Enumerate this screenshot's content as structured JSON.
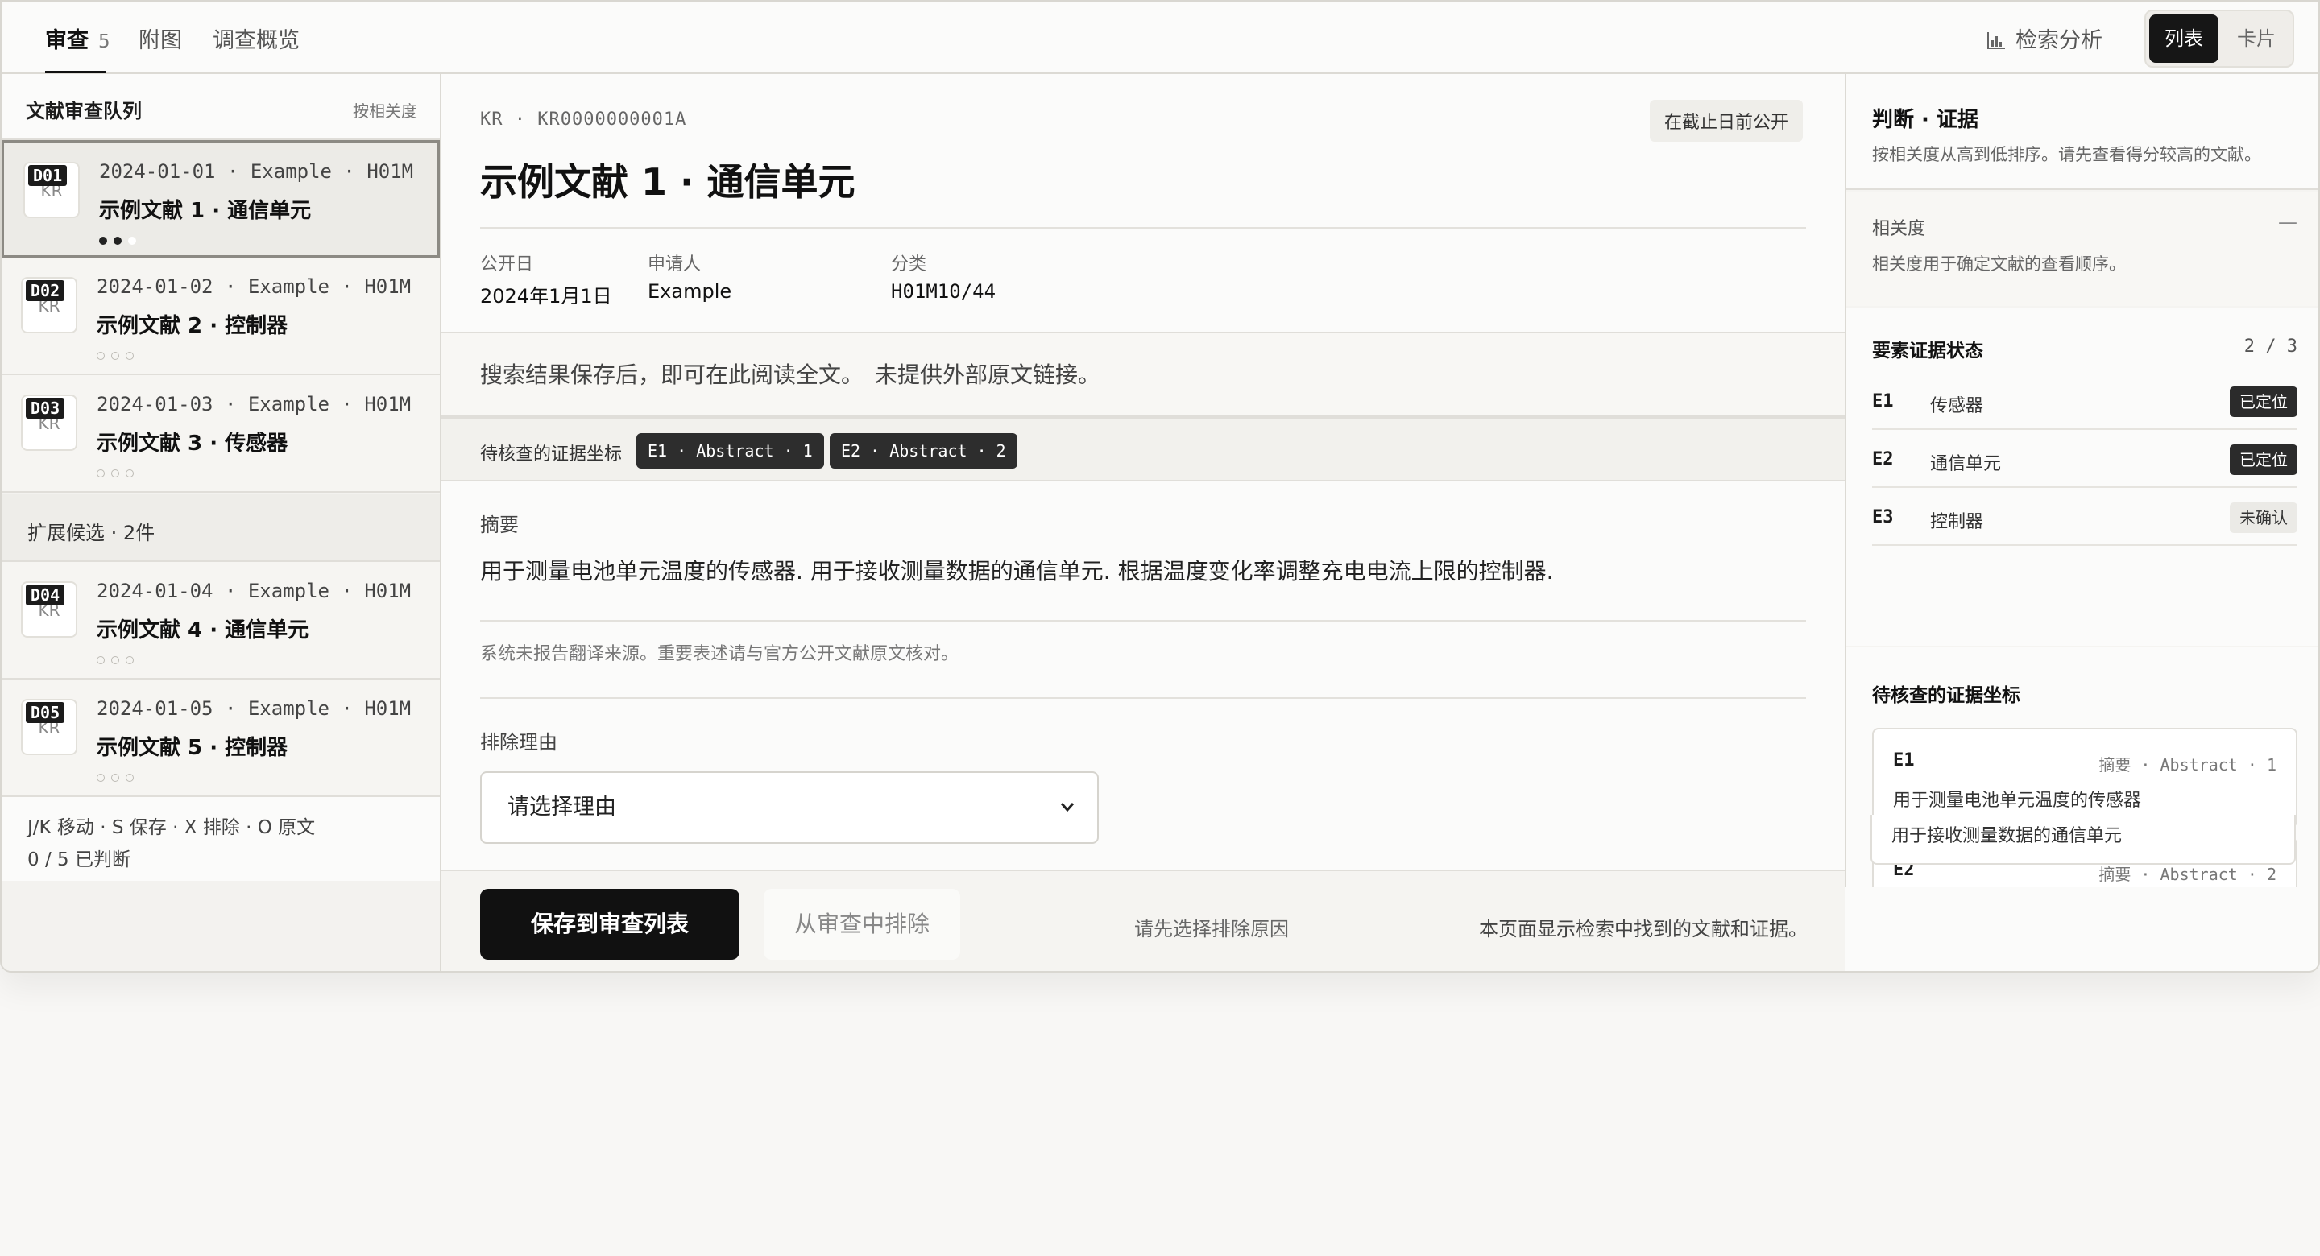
{
  "tabs": [
    {
      "label": "审查",
      "count": "5"
    },
    {
      "label": "附图"
    },
    {
      "label": "调查概览"
    }
  ],
  "header": {
    "analysis_label": "检索分析",
    "view_list": "列表",
    "view_card": "卡片"
  },
  "queue": {
    "title": "文献审查队列",
    "sort": "按相关度",
    "docs": [
      {
        "code": "D01",
        "country": "KR",
        "meta": "2024-01-01 · Example · H01M",
        "title": "示例文献 1 · 通信单元"
      },
      {
        "code": "D02",
        "country": "KR",
        "meta": "2024-01-02 · Example · H01M",
        "title": "示例文献 2 · 控制器"
      },
      {
        "code": "D03",
        "country": "KR",
        "meta": "2024-01-03 · Example · H01M",
        "title": "示例文献 3 · 传感器"
      },
      {
        "code": "D04",
        "country": "KR",
        "meta": "2024-01-04 · Example · H01M",
        "title": "示例文献 4 · 通信单元"
      },
      {
        "code": "D05",
        "country": "KR",
        "meta": "2024-01-05 · Example · H01M",
        "title": "示例文献 5 · 控制器"
      }
    ],
    "expand_label": "扩展候选 · 2件",
    "shortcuts": "J/K 移动 · S 保存 · X 排除 · O 原文",
    "progress": "0 / 5 已判断"
  },
  "document": {
    "id": "KR · KR0000000001A",
    "badge": "在截止日前公开",
    "title": "示例文献 1 · 通信单元",
    "pub_date_label": "公开日",
    "pub_date": "2024年1月1日",
    "applicant_label": "申请人",
    "applicant": "Example",
    "class_label": "分类",
    "class": "H01M10/44",
    "notice": "搜索结果保存后，即可在此阅读全文。　未提供外部原文链接。",
    "coords_label": "待核查的证据坐标",
    "coords": [
      "E1 · Abstract · 1",
      "E2 · Abstract · 2"
    ],
    "abstract_label": "摘要",
    "abstract": "用于测量电池单元温度的传感器. 用于接收测量数据的通信单元. 根据温度变化率调整充电电流上限的控制器.",
    "translation_note": "系统未报告翻译来源。重要表述请与官方公开文献原文核对。",
    "reason_label": "排除理由",
    "reason_placeholder": "请选择理由"
  },
  "actions": {
    "save": "保存到审查列表",
    "exclude": "从审查中排除",
    "hint_reason": "请先选择排除原因",
    "hint_page": "本页面显示检索中找到的文献和证据。"
  },
  "panel": {
    "title": "判断 · 证据",
    "subtitle": "按相关度从高到低排序。请先查看得分较高的文献。",
    "relevance_label": "相关度",
    "relevance_value": "—",
    "relevance_note": "相关度用于确定文献的查看顺序。",
    "evidence_title": "要素证据状态",
    "evidence_count": "2 / 3",
    "elements": [
      {
        "id": "E1",
        "name": "传感器",
        "status": "已定位"
      },
      {
        "id": "E2",
        "name": "通信单元",
        "status": "已定位"
      },
      {
        "id": "E3",
        "name": "控制器",
        "status": "未确认"
      }
    ],
    "coords_title": "待核查的证据坐标",
    "coord_cards": [
      {
        "id": "E1",
        "source": "摘要 · Abstract · 1",
        "text": "用于测量电池单元温度的传感器"
      },
      {
        "id": "E2",
        "source": "摘要 · Abstract · 2",
        "text": "用于接收测量数据的通信单元"
      }
    ]
  }
}
